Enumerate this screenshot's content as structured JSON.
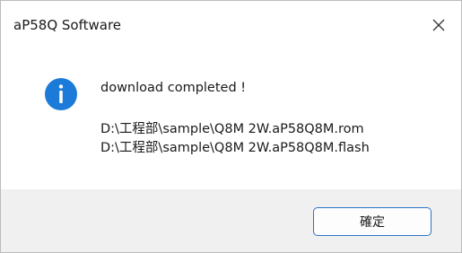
{
  "window": {
    "title": "aP58Q Software",
    "close_icon": "close-icon"
  },
  "message": {
    "icon": "info-icon",
    "icon_color": "#1c7bd8",
    "line1": "download completed !",
    "line2": "D:\\工程部\\sample\\Q8M 2W.aP58Q8M.rom",
    "line3": "D:\\工程部\\sample\\Q8M 2W.aP58Q8M.flash"
  },
  "buttons": {
    "ok_label": "確定"
  }
}
